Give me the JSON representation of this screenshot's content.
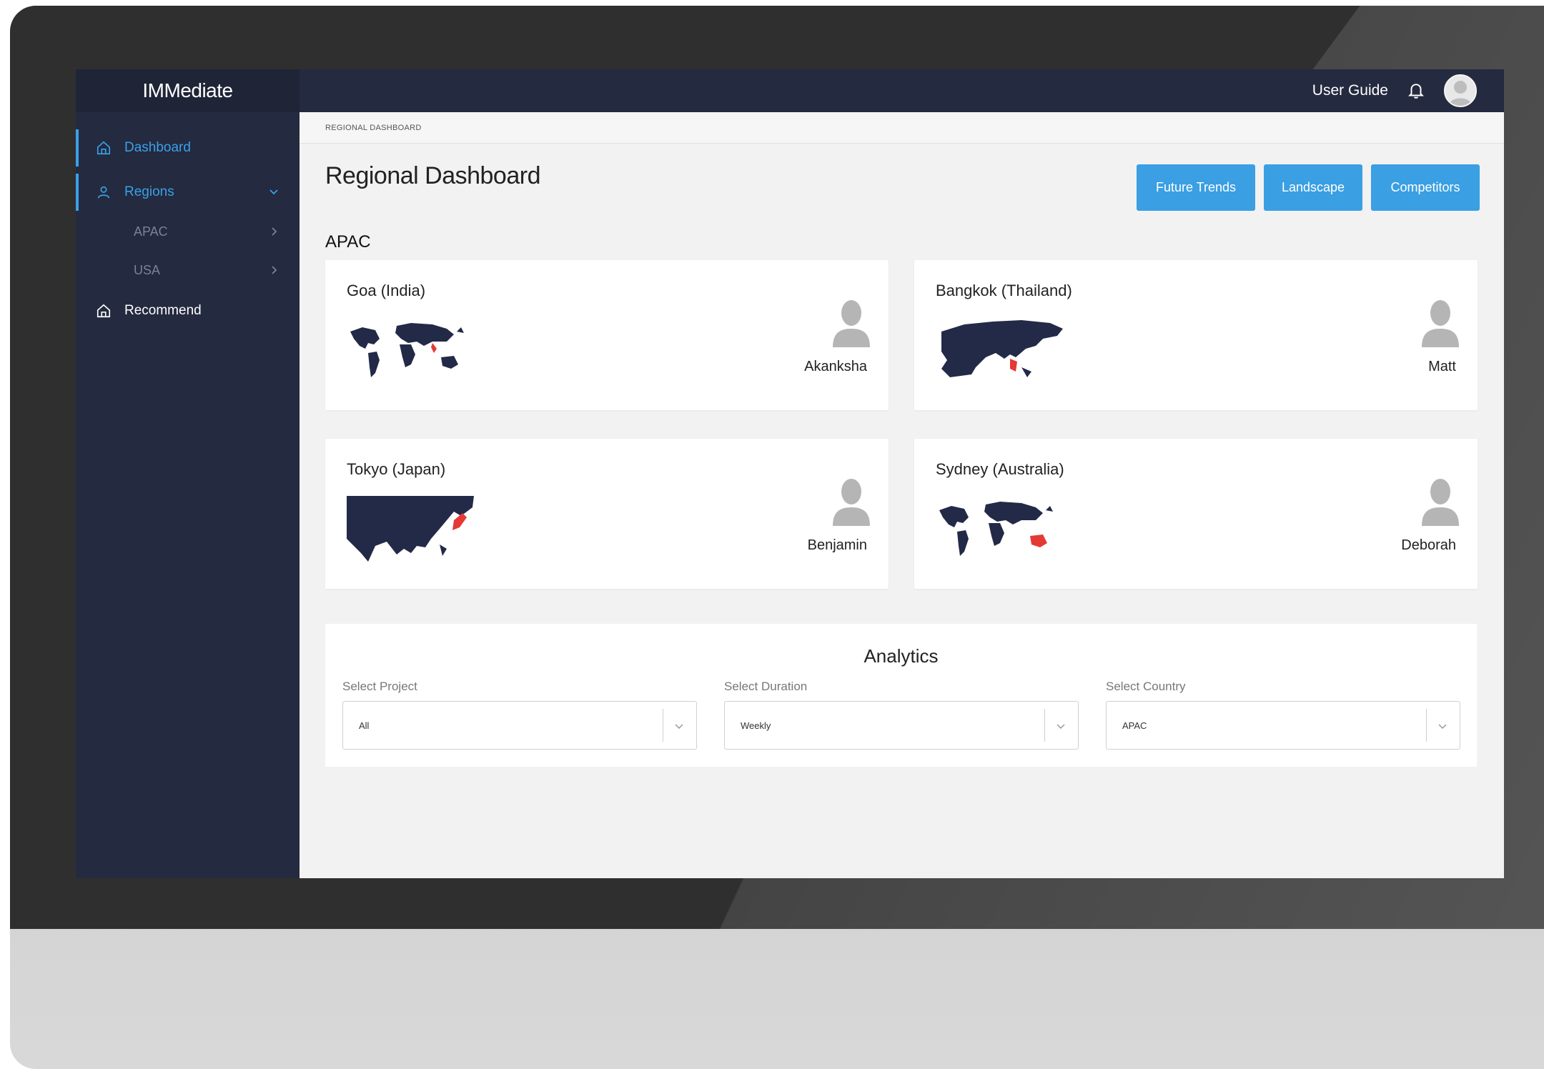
{
  "app": {
    "brand": "IMMediate"
  },
  "topbar": {
    "user_guide": "User Guide"
  },
  "sidebar": {
    "items": [
      {
        "label": "Dashboard",
        "icon": "home-icon",
        "active": true
      },
      {
        "label": "Regions",
        "icon": "user-icon",
        "active": true
      },
      {
        "label": "APAC",
        "sub": true
      },
      {
        "label": "USA",
        "sub": true
      },
      {
        "label": "Recommend",
        "icon": "home-icon",
        "active": false
      }
    ]
  },
  "breadcrumb": "REGIONAL DASHBOARD",
  "page": {
    "title": "Regional Dashboard",
    "buttons": {
      "future_trends": "Future Trends",
      "landscape": "Landscape",
      "competitors": "Competitors"
    },
    "section": "APAC"
  },
  "cards": [
    {
      "city": "Goa (India)",
      "person": "Akanksha",
      "map": "world-map-icon"
    },
    {
      "city": "Bangkok (Thailand)",
      "person": "Matt",
      "map": "asia-map-icon"
    },
    {
      "city": "Tokyo (Japan)",
      "person": "Benjamin",
      "map": "east-asia-map-icon"
    },
    {
      "city": "Sydney (Australia)",
      "person": "Deborah",
      "map": "world-map-icon"
    }
  ],
  "analytics": {
    "title": "Analytics",
    "project": {
      "label": "Select Project",
      "value": "All"
    },
    "duration": {
      "label": "Select Duration",
      "value": "Weekly"
    },
    "country": {
      "label": "Select Country",
      "value": "APAC"
    }
  },
  "colors": {
    "accent": "#3a9fe3",
    "sidebar": "#242a3f",
    "highlight": "#e53935",
    "map": "#232a47"
  }
}
